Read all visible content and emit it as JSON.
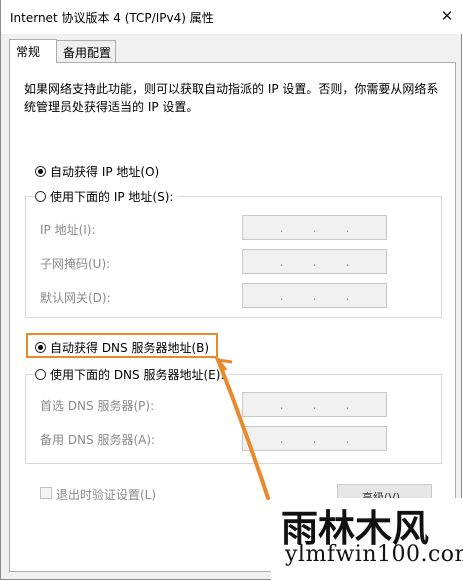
{
  "window": {
    "title": "Internet 协议版本 4 (TCP/IPv4) 属性"
  },
  "tabs": [
    {
      "label": "常规"
    },
    {
      "label": "备用配置"
    }
  ],
  "description": "如果网络支持此功能，则可以获取自动指派的 IP 设置。否则，你需要从网络系统管理员处获得适当的 IP 设置。",
  "ip_section": {
    "auto_label": "自动获得 IP 地址(O)",
    "manual_label": "使用下面的 IP 地址(S):",
    "selected": "auto",
    "fields": [
      {
        "label": "IP 地址(I):",
        "value": ".   .   ."
      },
      {
        "label": "子网掩码(U):",
        "value": ".   .   ."
      },
      {
        "label": "默认网关(D):",
        "value": ".   .   ."
      }
    ]
  },
  "dns_section": {
    "auto_label": "自动获得 DNS 服务器地址(B)",
    "manual_label": "使用下面的 DNS 服务器地址(E):",
    "selected": "auto",
    "fields": [
      {
        "label": "首选 DNS 服务器(P):",
        "value": ".   .   ."
      },
      {
        "label": "备用 DNS 服务器(A):",
        "value": ".   .   ."
      }
    ]
  },
  "validate_label": "退出时验证设置(L)",
  "advanced_button": "高级(V)...",
  "highlight_color": "#e8892b",
  "watermark": {
    "cn": "雨林木风",
    "en": "ylmfwin100.com"
  }
}
